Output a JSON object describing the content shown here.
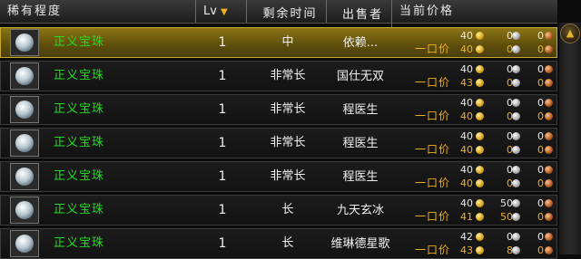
{
  "header": {
    "rarity": "稀有程度",
    "level": "Lv",
    "level_sort_icon": "sort-down-arrow-icon",
    "time_left": "剩余时间",
    "seller": "出售者",
    "current_price": "当前价格"
  },
  "buyout_label": "一口价",
  "rows": [
    {
      "name": "正义宝珠",
      "level": "1",
      "time": "中",
      "seller": "依赖...",
      "bid": {
        "gold": "40",
        "silver": "0",
        "copper": "0"
      },
      "buyout": {
        "gold": "40",
        "silver": "0",
        "copper": "0"
      }
    },
    {
      "name": "正义宝珠",
      "level": "1",
      "time": "非常长",
      "seller": "国仕无双",
      "bid": {
        "gold": "40",
        "silver": "0",
        "copper": "0"
      },
      "buyout": {
        "gold": "43",
        "silver": "0",
        "copper": "0"
      }
    },
    {
      "name": "正义宝珠",
      "level": "1",
      "time": "非常长",
      "seller": "程医生",
      "bid": {
        "gold": "40",
        "silver": "0",
        "copper": "0"
      },
      "buyout": {
        "gold": "40",
        "silver": "0",
        "copper": "0"
      }
    },
    {
      "name": "正义宝珠",
      "level": "1",
      "time": "非常长",
      "seller": "程医生",
      "bid": {
        "gold": "40",
        "silver": "0",
        "copper": "0"
      },
      "buyout": {
        "gold": "40",
        "silver": "0",
        "copper": "0"
      }
    },
    {
      "name": "正义宝珠",
      "level": "1",
      "time": "非常长",
      "seller": "程医生",
      "bid": {
        "gold": "40",
        "silver": "0",
        "copper": "0"
      },
      "buyout": {
        "gold": "40",
        "silver": "0",
        "copper": "0"
      }
    },
    {
      "name": "正义宝珠",
      "level": "1",
      "time": "长",
      "seller": "九天玄冰",
      "bid": {
        "gold": "40",
        "silver": "50",
        "copper": "0"
      },
      "buyout": {
        "gold": "41",
        "silver": "50",
        "copper": "0"
      }
    },
    {
      "name": "正义宝珠",
      "level": "1",
      "time": "长",
      "seller": "维琳德星歌",
      "bid": {
        "gold": "42",
        "silver": "0",
        "copper": "0"
      },
      "buyout": {
        "gold": "43",
        "silver": "8",
        "copper": "0"
      }
    }
  ],
  "selected_row": 0,
  "colors": {
    "item_name": "#22dd22",
    "buyout": "#f0b020",
    "selected_row": "#8a7414"
  }
}
